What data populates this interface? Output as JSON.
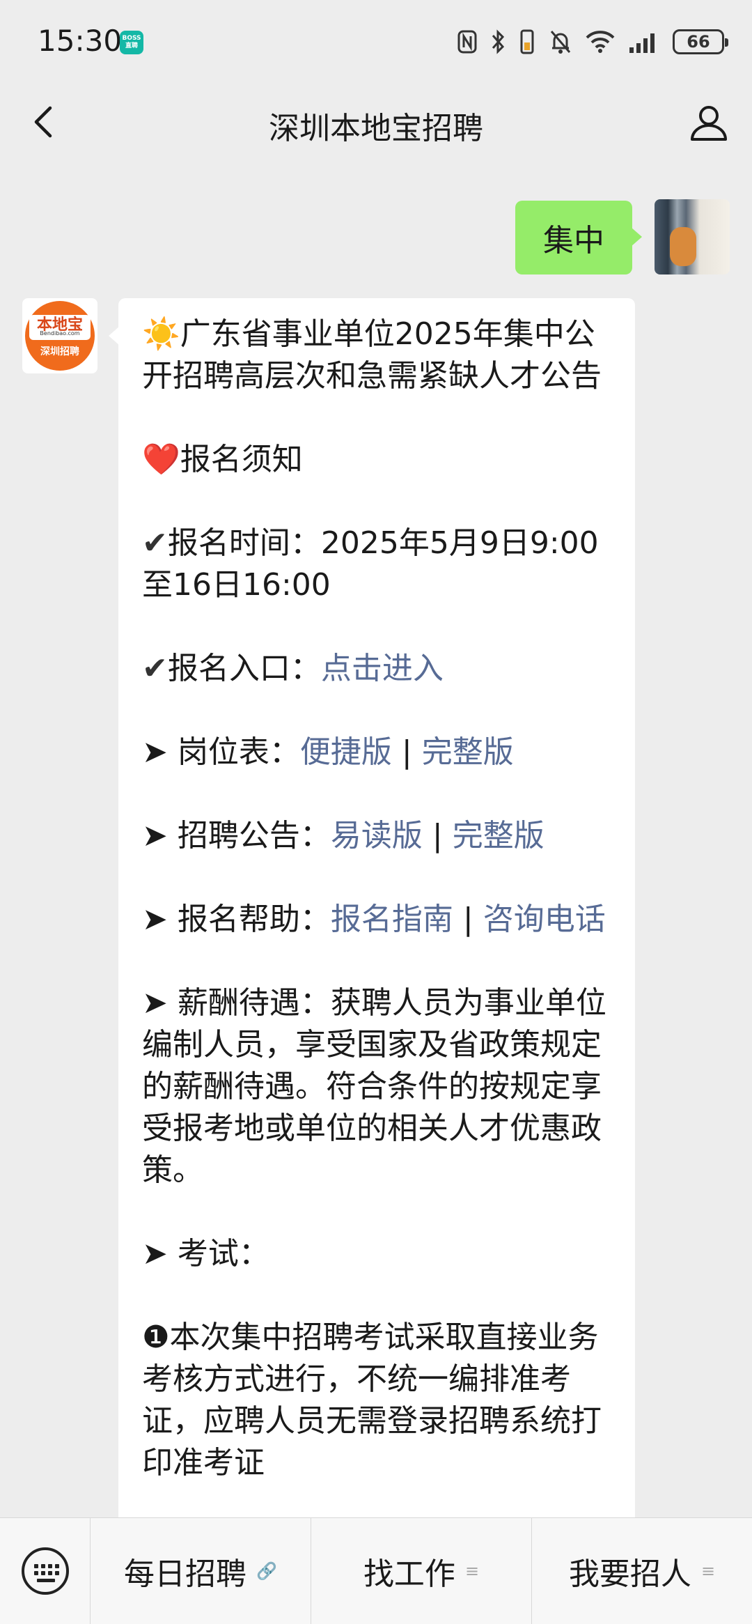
{
  "status_bar": {
    "time": "15:30",
    "badge": "BOSS直聘",
    "battery": "66"
  },
  "header": {
    "title": "深圳本地宝招聘"
  },
  "chat": {
    "user_message": "集中",
    "bot_avatar": {
      "logo_text": "本地宝",
      "domain_text": "Bendibao.com",
      "sub_text": "深圳招聘"
    },
    "bot_message": {
      "title_emoji": "☀️",
      "title": "广东省事业单位2025年集中公开招聘高层次和急需紧缺人才公告",
      "notice_emoji": "❤️",
      "notice": "报名须知",
      "check_mark": "✔",
      "time_label": "报名时间：",
      "time_value": "2025年5月9日9:00至16日16:00",
      "entry_label": "报名入口：",
      "entry_link": "点击进入",
      "arrow": "➤",
      "jobs_label": "岗位表：",
      "jobs_link1": "便捷版",
      "jobs_link2": "完整版",
      "announce_label": "招聘公告：",
      "announce_link1": "易读版",
      "announce_link2": "完整版",
      "help_label": "报名帮助：",
      "help_link1": "报名指南",
      "help_link2": "咨询电话",
      "separator": "|",
      "salary_label": "薪酬待遇：",
      "salary_text": "获聘人员为事业单位编制人员，享受国家及省政策规定的薪酬待遇。符合条件的按规定享受报考地或单位的相关人才优惠政策。",
      "exam_label": "考试：",
      "exam_num": "❶",
      "exam_text": "本次集中招聘考试采取直接业务考核方式进行，不统一编排准考证，应聘人员无需登录招聘系统打印准考证"
    }
  },
  "bottom_menu": {
    "items": [
      {
        "label": "每日招聘",
        "mark": "🔗"
      },
      {
        "label": "找工作",
        "mark": "≡"
      },
      {
        "label": "我要招人",
        "mark": "≡"
      }
    ]
  },
  "colors": {
    "user_bubble": "#95ec69",
    "link": "#576b95",
    "background": "#ededed",
    "brand_orange": "#f06b1c"
  },
  "icons": [
    "back-icon",
    "profile-icon",
    "nfc-icon",
    "bluetooth-icon",
    "vibrate-icon",
    "mute-icon",
    "wifi-icon",
    "signal-icon",
    "battery-icon",
    "keyboard-icon"
  ]
}
